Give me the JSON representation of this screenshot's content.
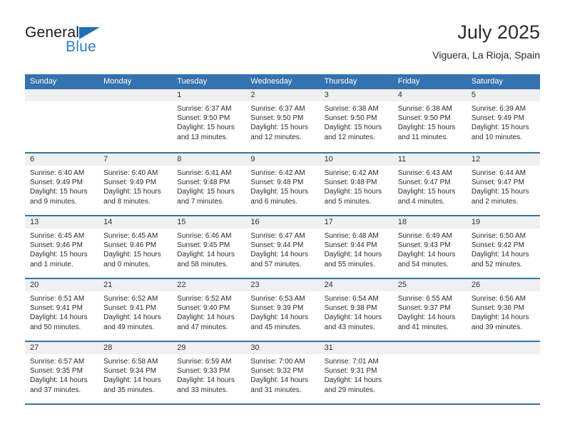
{
  "brand": {
    "name_top": "General",
    "name_bottom": "Blue",
    "triangle_icon": "triangle-icon",
    "color_dark": "#1a1a1a",
    "color_blue": "#2a7fc9"
  },
  "header": {
    "title": "July 2025",
    "subtitle": "Viguera, La Rioja, Spain"
  },
  "theme": {
    "header_blue": "#3572b0",
    "day_band_gray": "#f0f0f0",
    "text": "#2c2c2c"
  },
  "weekdays": [
    "Sunday",
    "Monday",
    "Tuesday",
    "Wednesday",
    "Thursday",
    "Friday",
    "Saturday"
  ],
  "weeks": [
    [
      {
        "empty": true
      },
      {
        "empty": true
      },
      {
        "day": "1",
        "sunrise": "Sunrise: 6:37 AM",
        "sunset": "Sunset: 9:50 PM",
        "daylight": "Daylight: 15 hours and 13 minutes."
      },
      {
        "day": "2",
        "sunrise": "Sunrise: 6:37 AM",
        "sunset": "Sunset: 9:50 PM",
        "daylight": "Daylight: 15 hours and 12 minutes."
      },
      {
        "day": "3",
        "sunrise": "Sunrise: 6:38 AM",
        "sunset": "Sunset: 9:50 PM",
        "daylight": "Daylight: 15 hours and 12 minutes."
      },
      {
        "day": "4",
        "sunrise": "Sunrise: 6:38 AM",
        "sunset": "Sunset: 9:50 PM",
        "daylight": "Daylight: 15 hours and 11 minutes."
      },
      {
        "day": "5",
        "sunrise": "Sunrise: 6:39 AM",
        "sunset": "Sunset: 9:49 PM",
        "daylight": "Daylight: 15 hours and 10 minutes."
      }
    ],
    [
      {
        "day": "6",
        "sunrise": "Sunrise: 6:40 AM",
        "sunset": "Sunset: 9:49 PM",
        "daylight": "Daylight: 15 hours and 9 minutes."
      },
      {
        "day": "7",
        "sunrise": "Sunrise: 6:40 AM",
        "sunset": "Sunset: 9:49 PM",
        "daylight": "Daylight: 15 hours and 8 minutes."
      },
      {
        "day": "8",
        "sunrise": "Sunrise: 6:41 AM",
        "sunset": "Sunset: 9:48 PM",
        "daylight": "Daylight: 15 hours and 7 minutes."
      },
      {
        "day": "9",
        "sunrise": "Sunrise: 6:42 AM",
        "sunset": "Sunset: 9:48 PM",
        "daylight": "Daylight: 15 hours and 6 minutes."
      },
      {
        "day": "10",
        "sunrise": "Sunrise: 6:42 AM",
        "sunset": "Sunset: 9:48 PM",
        "daylight": "Daylight: 15 hours and 5 minutes."
      },
      {
        "day": "11",
        "sunrise": "Sunrise: 6:43 AM",
        "sunset": "Sunset: 9:47 PM",
        "daylight": "Daylight: 15 hours and 4 minutes."
      },
      {
        "day": "12",
        "sunrise": "Sunrise: 6:44 AM",
        "sunset": "Sunset: 9:47 PM",
        "daylight": "Daylight: 15 hours and 2 minutes."
      }
    ],
    [
      {
        "day": "13",
        "sunrise": "Sunrise: 6:45 AM",
        "sunset": "Sunset: 9:46 PM",
        "daylight": "Daylight: 15 hours and 1 minute."
      },
      {
        "day": "14",
        "sunrise": "Sunrise: 6:45 AM",
        "sunset": "Sunset: 9:46 PM",
        "daylight": "Daylight: 15 hours and 0 minutes."
      },
      {
        "day": "15",
        "sunrise": "Sunrise: 6:46 AM",
        "sunset": "Sunset: 9:45 PM",
        "daylight": "Daylight: 14 hours and 58 minutes."
      },
      {
        "day": "16",
        "sunrise": "Sunrise: 6:47 AM",
        "sunset": "Sunset: 9:44 PM",
        "daylight": "Daylight: 14 hours and 57 minutes."
      },
      {
        "day": "17",
        "sunrise": "Sunrise: 6:48 AM",
        "sunset": "Sunset: 9:44 PM",
        "daylight": "Daylight: 14 hours and 55 minutes."
      },
      {
        "day": "18",
        "sunrise": "Sunrise: 6:49 AM",
        "sunset": "Sunset: 9:43 PM",
        "daylight": "Daylight: 14 hours and 54 minutes."
      },
      {
        "day": "19",
        "sunrise": "Sunrise: 6:50 AM",
        "sunset": "Sunset: 9:42 PM",
        "daylight": "Daylight: 14 hours and 52 minutes."
      }
    ],
    [
      {
        "day": "20",
        "sunrise": "Sunrise: 6:51 AM",
        "sunset": "Sunset: 9:41 PM",
        "daylight": "Daylight: 14 hours and 50 minutes."
      },
      {
        "day": "21",
        "sunrise": "Sunrise: 6:52 AM",
        "sunset": "Sunset: 9:41 PM",
        "daylight": "Daylight: 14 hours and 49 minutes."
      },
      {
        "day": "22",
        "sunrise": "Sunrise: 6:52 AM",
        "sunset": "Sunset: 9:40 PM",
        "daylight": "Daylight: 14 hours and 47 minutes."
      },
      {
        "day": "23",
        "sunrise": "Sunrise: 6:53 AM",
        "sunset": "Sunset: 9:39 PM",
        "daylight": "Daylight: 14 hours and 45 minutes."
      },
      {
        "day": "24",
        "sunrise": "Sunrise: 6:54 AM",
        "sunset": "Sunset: 9:38 PM",
        "daylight": "Daylight: 14 hours and 43 minutes."
      },
      {
        "day": "25",
        "sunrise": "Sunrise: 6:55 AM",
        "sunset": "Sunset: 9:37 PM",
        "daylight": "Daylight: 14 hours and 41 minutes."
      },
      {
        "day": "26",
        "sunrise": "Sunrise: 6:56 AM",
        "sunset": "Sunset: 9:36 PM",
        "daylight": "Daylight: 14 hours and 39 minutes."
      }
    ],
    [
      {
        "day": "27",
        "sunrise": "Sunrise: 6:57 AM",
        "sunset": "Sunset: 9:35 PM",
        "daylight": "Daylight: 14 hours and 37 minutes."
      },
      {
        "day": "28",
        "sunrise": "Sunrise: 6:58 AM",
        "sunset": "Sunset: 9:34 PM",
        "daylight": "Daylight: 14 hours and 35 minutes."
      },
      {
        "day": "29",
        "sunrise": "Sunrise: 6:59 AM",
        "sunset": "Sunset: 9:33 PM",
        "daylight": "Daylight: 14 hours and 33 minutes."
      },
      {
        "day": "30",
        "sunrise": "Sunrise: 7:00 AM",
        "sunset": "Sunset: 9:32 PM",
        "daylight": "Daylight: 14 hours and 31 minutes."
      },
      {
        "day": "31",
        "sunrise": "Sunrise: 7:01 AM",
        "sunset": "Sunset: 9:31 PM",
        "daylight": "Daylight: 14 hours and 29 minutes."
      },
      {
        "empty": true
      },
      {
        "empty": true
      }
    ]
  ]
}
